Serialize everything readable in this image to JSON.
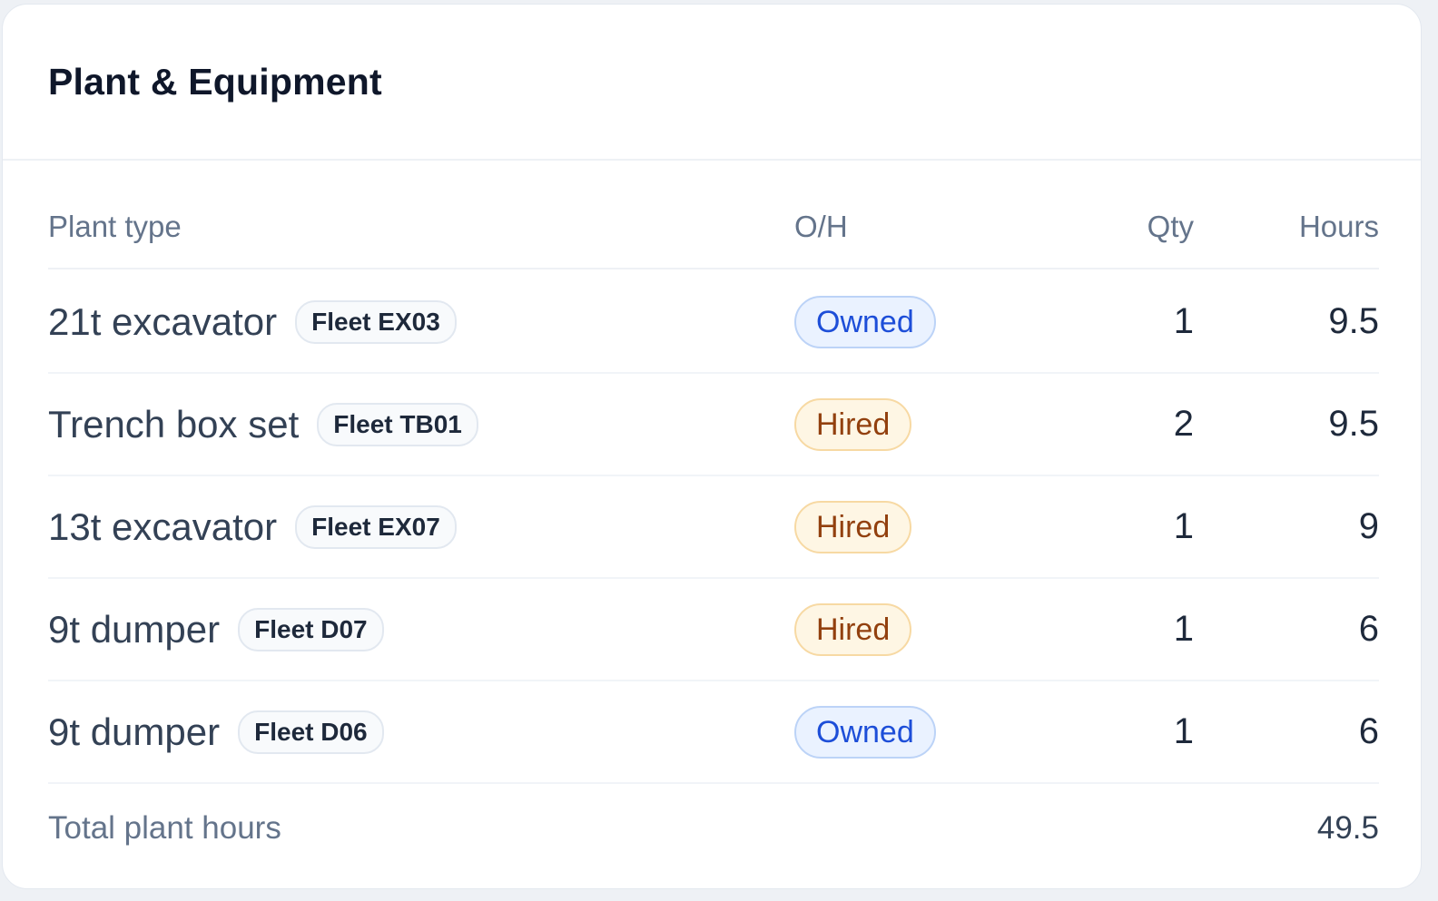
{
  "card": {
    "title": "Plant & Equipment"
  },
  "table": {
    "headers": {
      "plant_type": "Plant type",
      "oh": "O/H",
      "qty": "Qty",
      "hours": "Hours"
    },
    "rows": [
      {
        "plant_type": "21t excavator",
        "fleet": "Fleet EX03",
        "oh": "Owned",
        "qty": "1",
        "hours": "9.5"
      },
      {
        "plant_type": "Trench box set",
        "fleet": "Fleet TB01",
        "oh": "Hired",
        "qty": "2",
        "hours": "9.5"
      },
      {
        "plant_type": "13t excavator",
        "fleet": "Fleet EX07",
        "oh": "Hired",
        "qty": "1",
        "hours": "9"
      },
      {
        "plant_type": "9t dumper",
        "fleet": "Fleet D07",
        "oh": "Hired",
        "qty": "1",
        "hours": "6"
      },
      {
        "plant_type": "9t dumper",
        "fleet": "Fleet D06",
        "oh": "Owned",
        "qty": "1",
        "hours": "6"
      }
    ],
    "total": {
      "label": "Total plant hours",
      "value": "49.5"
    }
  },
  "colors": {
    "owned_text": "#1d4ed8",
    "owned_bg": "#eaf2ff",
    "hired_text": "#92400e",
    "hired_bg": "#fef6e4",
    "title_text": "#0f172a",
    "muted_text": "#64748b"
  }
}
